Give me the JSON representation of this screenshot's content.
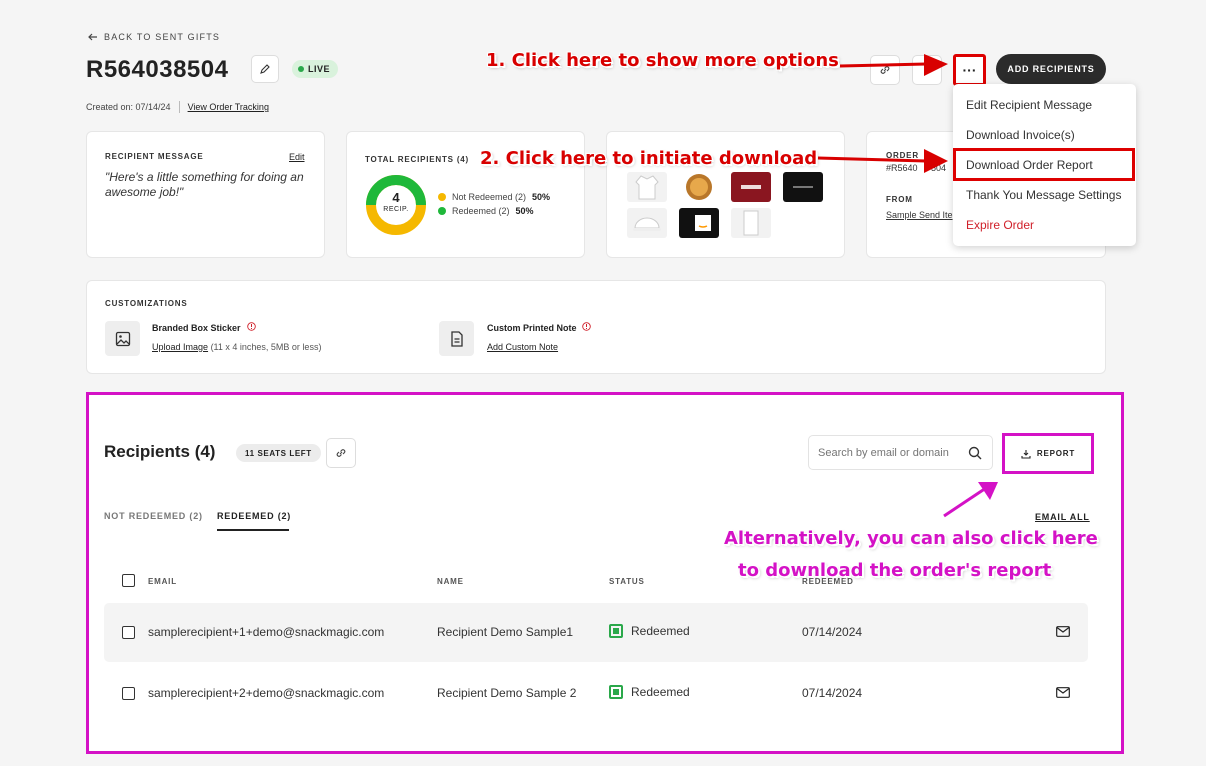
{
  "header": {
    "back_label": "BACK TO SENT GIFTS",
    "order_id": "R564038504",
    "status_badge": "LIVE",
    "created_label": "Created on: 07/14/24",
    "tracking_link": "View Order Tracking",
    "add_recipients": "ADD RECIPIENTS",
    "more_label": "···"
  },
  "menu": {
    "items": [
      "Edit Recipient Message",
      "Download Invoice(s)",
      "Download Order Report",
      "Thank You Message Settings",
      "Expire Order"
    ]
  },
  "message_card": {
    "title": "RECIPIENT MESSAGE",
    "edit": "Edit",
    "text": "\"Here's a little something for doing an awesome job!\""
  },
  "recipients_card": {
    "title": "TOTAL RECIPIENTS (4)",
    "donut_value": "4",
    "donut_unit": "RECIP.",
    "legend": [
      {
        "label": "Not Redeemed (2)",
        "pct": "50%",
        "color": "#f5b800",
        "fraction": 0.5
      },
      {
        "label": "Redeemed (2)",
        "pct": "50%",
        "color": "#1fb83a",
        "fraction": 0.5
      }
    ]
  },
  "order_card": {
    "label_partial": "ORDER",
    "id_partial": "#R5640",
    "id_tail": "504",
    "from_label": "FROM",
    "from_value": "Sample Send Ite"
  },
  "customizations": {
    "title": "CUSTOMIZATIONS",
    "sticker_title": "Branded Box Sticker",
    "sticker_link": "Upload Image",
    "sticker_hint": "(11 x 4 inches, 5MB or less)",
    "note_title": "Custom Printed Note",
    "note_link": "Add Custom Note"
  },
  "recipients": {
    "title": "Recipients (4)",
    "seats": "11 SEATS LEFT",
    "search_placeholder": "Search by email or domain",
    "report_label": "REPORT",
    "tabs": [
      "NOT REDEEMED (2)",
      "REDEEMED (2)"
    ],
    "email_all": "EMAIL ALL",
    "columns": [
      "EMAIL",
      "NAME",
      "STATUS",
      "REDEEMED"
    ],
    "rows": [
      {
        "email": "samplerecipient+1+demo@snackmagic.com",
        "name": "Recipient Demo Sample1",
        "status": "Redeemed",
        "date": "07/14/2024"
      },
      {
        "email": "samplerecipient+2+demo@snackmagic.com",
        "name": "Recipient Demo Sample 2",
        "status": "Redeemed",
        "date": "07/14/2024"
      }
    ]
  },
  "annotations": {
    "step1": "1. Click here to show more options",
    "step2": "2. Click here to initiate download",
    "alt_line1": "Alternatively, you can also click here",
    "alt_line2": "to download the order's report"
  },
  "colors": {
    "annotation_red": "#d80000",
    "annotation_magenta": "#d412c6",
    "danger": "#d0202a",
    "success": "#2aa84a"
  }
}
